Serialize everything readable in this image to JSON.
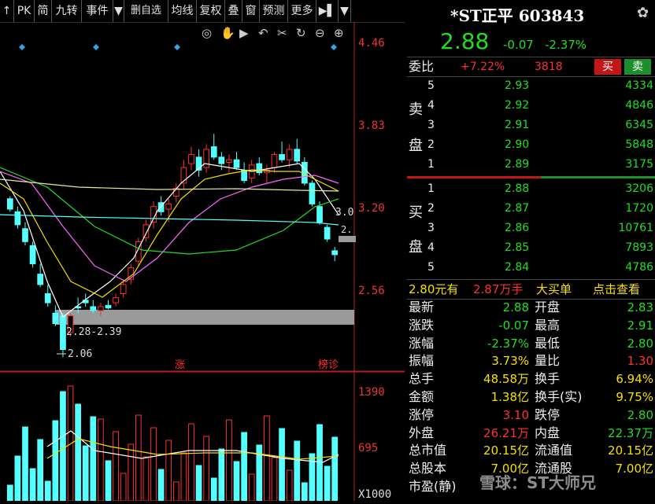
{
  "toolbar": {
    "items": [
      "↑",
      "PK",
      "简",
      "九转",
      "事件",
      "▼",
      "删自选",
      "均线",
      "复权",
      "叠",
      "窗",
      "预测",
      "更多",
      "▶▌",
      "▼"
    ]
  },
  "chart_tools": [
    "◎",
    "✋",
    "▶",
    "↶",
    "✂",
    "↻",
    "⊖",
    "⊕"
  ],
  "price_axis": [
    "4.46",
    "3.83",
    "3.20",
    "2.56"
  ],
  "volume_axis": [
    "1390",
    "695",
    "X1000"
  ],
  "annotations": {
    "range": "2.28-2.39",
    "low": "2.06",
    "last_tag": "3.0",
    "last_tag2": "2.",
    "zhang": "涨",
    "bangzhen": "榜诊"
  },
  "header": {
    "title": "*ST正平 603843",
    "price": "2.88",
    "change": "-0.07",
    "change_pct": "-2.37%"
  },
  "weibi": {
    "label": "委比",
    "ratio": "+7.22%",
    "diff": "3818",
    "sell_btn": "买",
    "buy_btn": "卖"
  },
  "sell_side_labels": [
    "卖",
    "盘"
  ],
  "buy_side_labels": [
    "买",
    "盘"
  ],
  "asks": [
    {
      "level": "5",
      "price": "2.93",
      "vol": "4334"
    },
    {
      "level": "4",
      "price": "2.92",
      "vol": "4846"
    },
    {
      "level": "3",
      "price": "2.91",
      "vol": "6345"
    },
    {
      "level": "2",
      "price": "2.90",
      "vol": "5848"
    },
    {
      "level": "1",
      "price": "2.89",
      "vol": "3175"
    }
  ],
  "bids": [
    {
      "level": "1",
      "price": "2.88",
      "vol": "3206"
    },
    {
      "level": "2",
      "price": "2.87",
      "vol": "1720"
    },
    {
      "level": "3",
      "price": "2.86",
      "vol": "10761"
    },
    {
      "level": "4",
      "price": "2.85",
      "vol": "7893"
    },
    {
      "level": "5",
      "price": "2.84",
      "vol": "4786"
    }
  ],
  "big_order": {
    "price_text": "2.80元有",
    "amount": "2.87万手",
    "label": "大买单",
    "link": "点击查看"
  },
  "stats": [
    {
      "l1": "最新",
      "v1": "2.88",
      "c1": "green",
      "l2": "开盘",
      "v2": "2.83",
      "c2": "green"
    },
    {
      "l1": "涨跌",
      "v1": "-0.07",
      "c1": "green",
      "l2": "最高",
      "v2": "2.91",
      "c2": "green"
    },
    {
      "l1": "涨幅",
      "v1": "-2.37%",
      "c1": "green",
      "l2": "最低",
      "v2": "2.80",
      "c2": "green"
    },
    {
      "l1": "振幅",
      "v1": "3.73%",
      "c1": "yellow",
      "l2": "量比",
      "v2": "1.30",
      "c2": "red"
    },
    {
      "l1": "总手",
      "v1": "48.58万",
      "c1": "yellow",
      "l2": "换手",
      "v2": "6.94%",
      "c2": "yellow"
    },
    {
      "l1": "金额",
      "v1": "1.38亿",
      "c1": "yellow",
      "l2": "换手(实)",
      "v2": "9.75%",
      "c2": "yellow"
    },
    {
      "l1": "涨停",
      "v1": "3.10",
      "c1": "red",
      "l2": "跌停",
      "v2": "2.80",
      "c2": "green"
    },
    {
      "l1": "外盘",
      "v1": "26.21万",
      "c1": "red",
      "l2": "内盘",
      "v2": "22.37万",
      "c2": "green"
    },
    {
      "l1": "总市值",
      "v1": "20.15亿",
      "c1": "yellow",
      "l2": "流通值",
      "v2": "20.15亿",
      "c2": "yellow"
    },
    {
      "l1": "总股本",
      "v1": "7.00亿",
      "c1": "yellow",
      "l2": "流通股",
      "v2": "7.00亿",
      "c2": "yellow"
    },
    {
      "l1": "市盈(静)",
      "v1": "",
      "c1": "yellow",
      "l2": "",
      "v2": "",
      "c2": "yellow"
    }
  ],
  "watermark": "雪球：ST大师兄",
  "colors": {
    "up": "#ff3030",
    "down": "#22dd22",
    "bg": "#000000",
    "yellow": "#f5e000",
    "cyan": "#54ffff"
  }
}
